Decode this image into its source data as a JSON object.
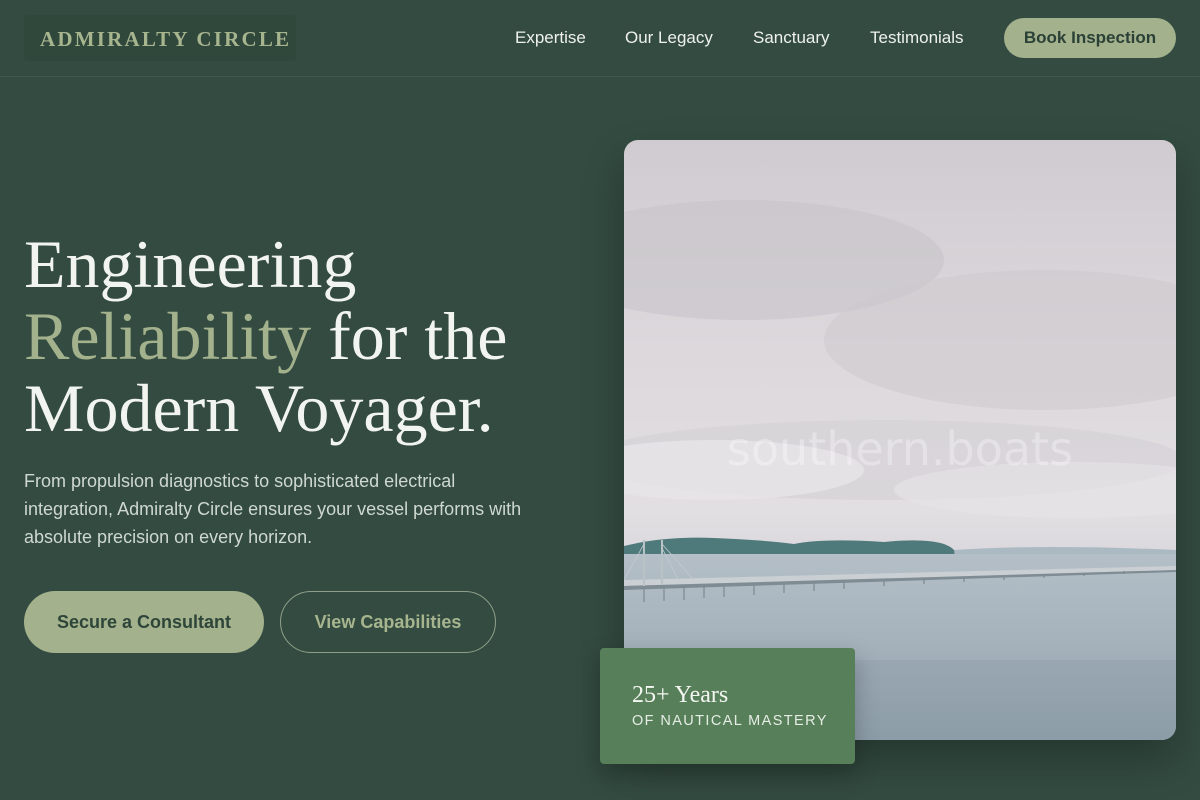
{
  "brand": "ADMIRALTY CIRCLE",
  "nav": {
    "links": [
      "Expertise",
      "Our Legacy",
      "Sanctuary",
      "Testimonials"
    ],
    "cta": "Book Inspection"
  },
  "hero": {
    "line1": "Engineering",
    "accent": "Reliability",
    "line2_rest": " for the",
    "line3": "Modern Voyager.",
    "subtitle": "From propulsion diagnostics to sophisticated electrical integration, Admiralty Circle ensures your vessel performs with absolute precision on every horizon.",
    "primary_cta": "Secure a Consultant",
    "secondary_cta": "View Capabilities"
  },
  "image": {
    "watermark": "southern.boats"
  },
  "badge": {
    "title": "25+ Years",
    "subtitle": "OF NAUTICAL MASTERY"
  },
  "colors": {
    "background": "#334b40",
    "accent": "#a3b28d",
    "badge": "#577f59"
  }
}
